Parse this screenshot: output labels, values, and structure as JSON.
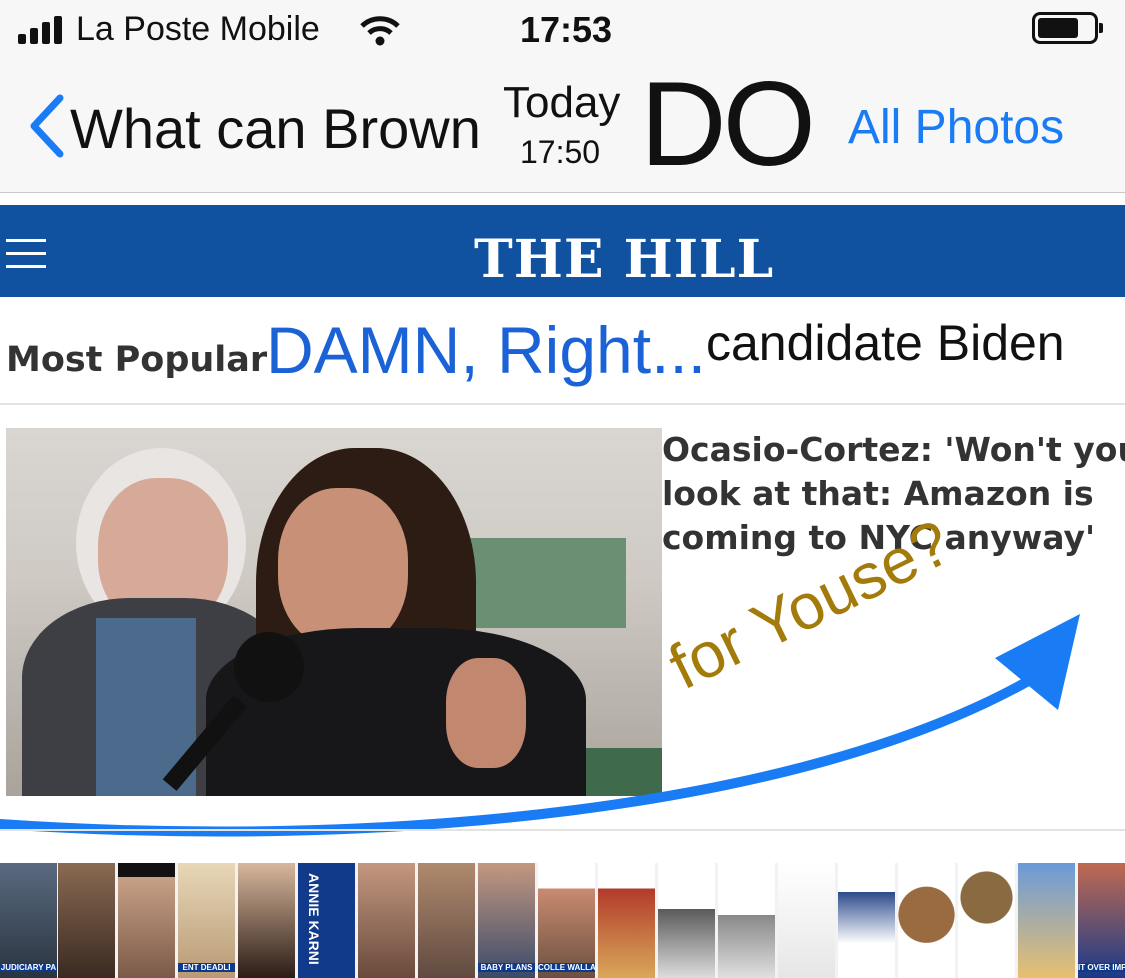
{
  "status_bar": {
    "carrier": "La Poste Mobile",
    "time": "17:53"
  },
  "nav": {
    "back_label": "What can Brown",
    "date_label": "Today",
    "time_label": "17:50",
    "overlay_do": "DO",
    "all_photos": "All Photos"
  },
  "site": {
    "logo": "THE HILL"
  },
  "section": {
    "most_popular": "Most Popular",
    "overlay_damn": "DAMN, Right...",
    "overlay_candidate": "candidate Biden"
  },
  "article": {
    "headline_line1": "Ocasio-Cortez: 'Won't you",
    "headline_line2": "look at that: Amazon is",
    "headline_line3": "coming to NYC anyway'"
  },
  "overlay": {
    "for_youse": "for Youse?"
  },
  "thumbnails": {
    "t6_label": "ANNIE KARNI",
    "t4_label": "ENT DEADLI",
    "t1_label": "JUDICIARY PA",
    "t8_label": "BABY PLANS",
    "t9_label": "COLLE WALLACE",
    "t18_label": "IT OVER IMPEACH"
  },
  "colors": {
    "ios_blue": "#1a7cf5",
    "hill_blue": "#1152a0",
    "overlay_gold": "#a37b0b"
  }
}
